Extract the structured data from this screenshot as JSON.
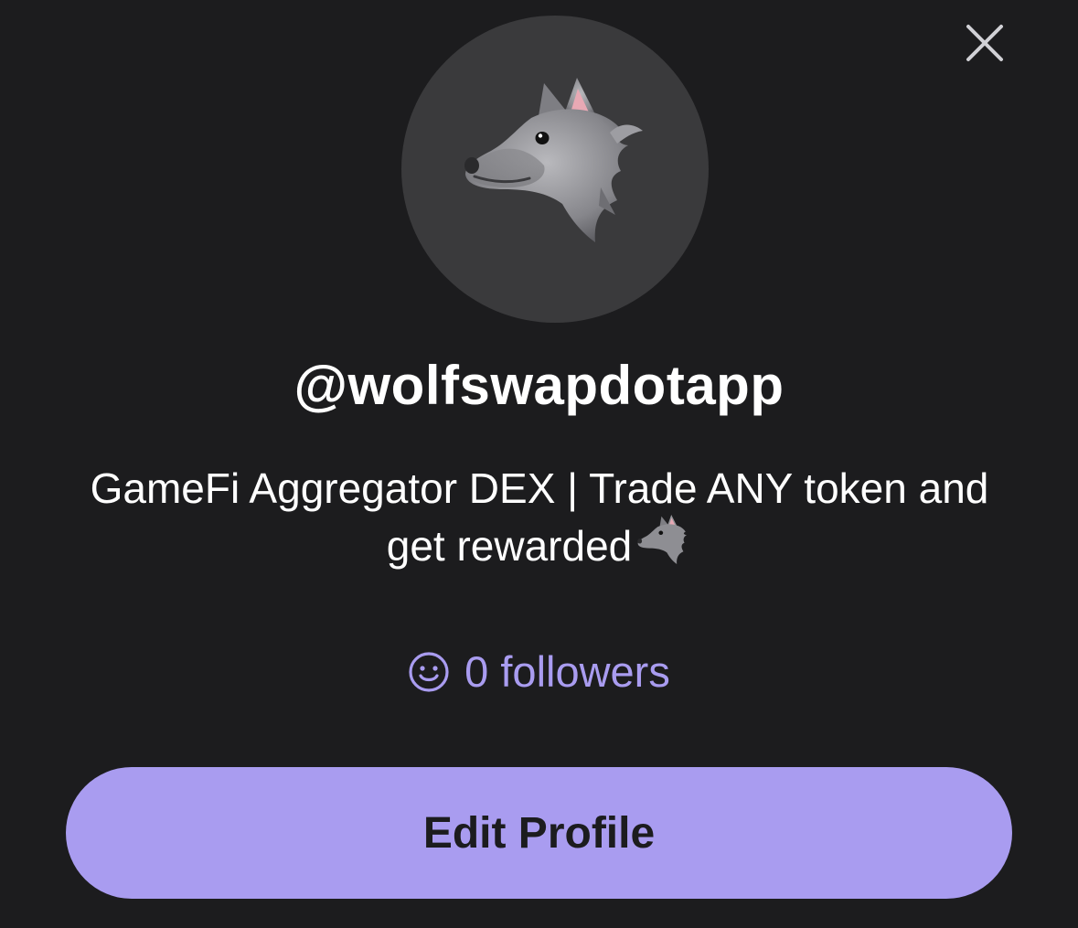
{
  "sheet": {
    "close_icon": "close-icon",
    "avatar_icon": "wolf-emoji-icon"
  },
  "profile": {
    "username": "@wolfswapdotapp",
    "bio": "GameFi Aggregator DEX | Trade ANY token and get rewarded",
    "bio_emoji_icon": "wolf-emoji-icon",
    "followers_icon": "smiley-icon",
    "followers_text": "0 followers"
  },
  "actions": {
    "edit_profile_label": "Edit Profile"
  },
  "colors": {
    "background": "#1c1c1e",
    "avatar_bg": "#3a3a3c",
    "accent": "#a99cf0",
    "text_primary": "#ffffff",
    "button_text": "#1c1c1e"
  }
}
